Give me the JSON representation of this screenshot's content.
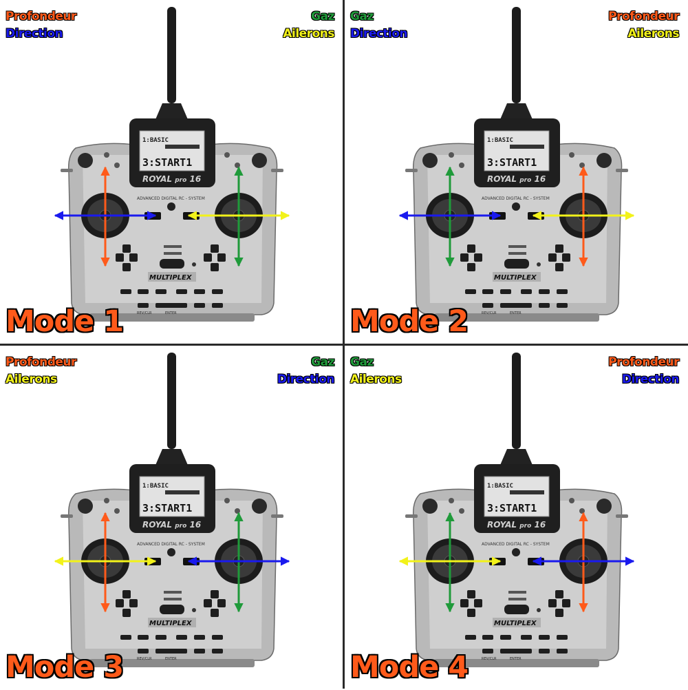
{
  "colors": {
    "profondeur": "#ff5a1a",
    "direction": "#1a1aee",
    "gaz": "#1f9a3a",
    "ailerons": "#f2f21a"
  },
  "device": {
    "screen_line1": "1:BASIC",
    "screen_line2": "3:START1",
    "brand": "ROYAL",
    "brand_suffix": "pro",
    "brand_num": "16",
    "subtitle": "ADVANCED DIGITAL RC - SYSTEM",
    "maker": "MULTIPLEX",
    "btn_revclr": "REV/CLR",
    "btn_enter": "ENTER"
  },
  "quadrants": [
    {
      "mode": "Mode 1",
      "left_top": "Profondeur",
      "left_bottom": "Direction",
      "right_top": "Gaz",
      "right_bottom": "Ailerons"
    },
    {
      "mode": "Mode 2",
      "left_top": "Gaz",
      "left_bottom": "Direction",
      "right_top": "Profondeur",
      "right_bottom": "Ailerons"
    },
    {
      "mode": "Mode 3",
      "left_top": "Profondeur",
      "left_bottom": "Ailerons",
      "right_top": "Gaz",
      "right_bottom": "Direction"
    },
    {
      "mode": "Mode 4",
      "left_top": "Gaz",
      "left_bottom": "Ailerons",
      "right_top": "Profondeur",
      "right_bottom": "Direction"
    }
  ]
}
